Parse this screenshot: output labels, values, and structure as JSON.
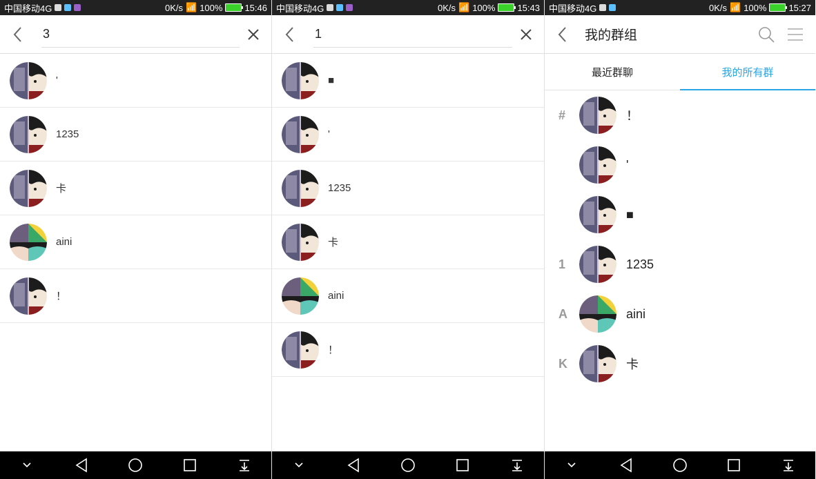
{
  "screens": [
    {
      "status": {
        "carrier": "中国移动4G",
        "net": "0K/s",
        "battery": "100%",
        "time": "15:46"
      },
      "search": {
        "value": "3"
      },
      "results": [
        {
          "name": "'",
          "avatar": "split"
        },
        {
          "name": "1235",
          "avatar": "split"
        },
        {
          "name": "卡",
          "avatar": "split"
        },
        {
          "name": "aini",
          "avatar": "grid"
        },
        {
          "name": "！",
          "avatar": "split"
        }
      ]
    },
    {
      "status": {
        "carrier": "中国移动4G",
        "net": "0K/s",
        "battery": "100%",
        "time": "15:43"
      },
      "search": {
        "value": "1"
      },
      "results": [
        {
          "name": "■",
          "avatar": "split"
        },
        {
          "name": "'",
          "avatar": "split"
        },
        {
          "name": "1235",
          "avatar": "split"
        },
        {
          "name": "卡",
          "avatar": "split"
        },
        {
          "name": "aini",
          "avatar": "grid"
        },
        {
          "name": "！",
          "avatar": "split"
        }
      ]
    },
    {
      "status": {
        "carrier": "中国移动4G",
        "net": "0K/s",
        "battery": "100%",
        "time": "15:27"
      },
      "title": "我的群组",
      "tabs": [
        {
          "label": "最近群聊",
          "active": false
        },
        {
          "label": "我的所有群",
          "active": true
        }
      ],
      "groups": [
        {
          "index": "#",
          "name": "！",
          "avatar": "split"
        },
        {
          "index": "",
          "name": "'",
          "avatar": "split"
        },
        {
          "index": "",
          "name": "■",
          "avatar": "split"
        },
        {
          "index": "1",
          "name": "1235",
          "avatar": "split"
        },
        {
          "index": "A",
          "name": "aini",
          "avatar": "grid"
        },
        {
          "index": "K",
          "name": "卡",
          "avatar": "split"
        }
      ]
    }
  ],
  "colors": {
    "accent": "#2aa6e6",
    "statusbar": "#222222",
    "navbar": "#000000",
    "battery": "#39d12a"
  },
  "icons": {
    "back": "chevron-left-icon",
    "clear": "close-icon",
    "search": "search-icon",
    "menu": "menu-icon",
    "nav": [
      "chevron-down-icon",
      "triangle-back-icon",
      "circle-home-icon",
      "square-recents-icon",
      "notification-pull-icon"
    ]
  }
}
